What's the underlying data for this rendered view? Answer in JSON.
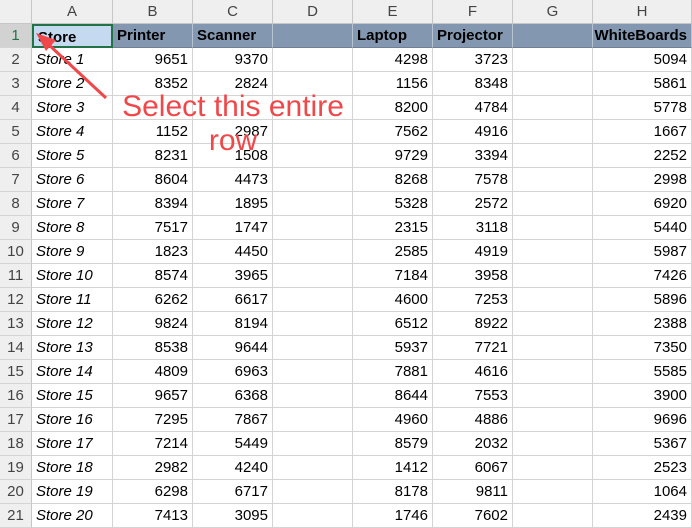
{
  "columns": [
    "A",
    "B",
    "C",
    "D",
    "E",
    "F",
    "G",
    "H"
  ],
  "row_numbers": [
    "1",
    "2",
    "3",
    "4",
    "5",
    "6",
    "7",
    "8",
    "9",
    "10",
    "11",
    "12",
    "13",
    "14",
    "15",
    "16",
    "17",
    "18",
    "19",
    "20",
    "21"
  ],
  "header_row": [
    "Store",
    "Printer",
    "Scanner",
    "",
    "Laptop",
    "Projector",
    "",
    "WhiteBoards"
  ],
  "rows": [
    [
      "Store 1",
      "9651",
      "9370",
      "",
      "4298",
      "3723",
      "",
      "5094"
    ],
    [
      "Store 2",
      "8352",
      "2824",
      "",
      "1156",
      "8348",
      "",
      "5861"
    ],
    [
      "Store 3",
      "",
      "",
      "",
      "8200",
      "4784",
      "",
      "5778"
    ],
    [
      "Store 4",
      "1152",
      "2987",
      "",
      "7562",
      "4916",
      "",
      "1667"
    ],
    [
      "Store 5",
      "8231",
      "1508",
      "",
      "9729",
      "3394",
      "",
      "2252"
    ],
    [
      "Store 6",
      "8604",
      "4473",
      "",
      "8268",
      "7578",
      "",
      "2998"
    ],
    [
      "Store 7",
      "8394",
      "1895",
      "",
      "5328",
      "2572",
      "",
      "6920"
    ],
    [
      "Store 8",
      "7517",
      "1747",
      "",
      "2315",
      "3118",
      "",
      "5440"
    ],
    [
      "Store 9",
      "1823",
      "4450",
      "",
      "2585",
      "4919",
      "",
      "5987"
    ],
    [
      "Store 10",
      "8574",
      "3965",
      "",
      "7184",
      "3958",
      "",
      "7426"
    ],
    [
      "Store 11",
      "6262",
      "6617",
      "",
      "4600",
      "7253",
      "",
      "5896"
    ],
    [
      "Store 12",
      "9824",
      "8194",
      "",
      "6512",
      "8922",
      "",
      "2388"
    ],
    [
      "Store 13",
      "8538",
      "9644",
      "",
      "5937",
      "7721",
      "",
      "7350"
    ],
    [
      "Store 14",
      "4809",
      "6963",
      "",
      "7881",
      "4616",
      "",
      "5585"
    ],
    [
      "Store 15",
      "9657",
      "6368",
      "",
      "8644",
      "7553",
      "",
      "3900"
    ],
    [
      "Store 16",
      "7295",
      "7867",
      "",
      "4960",
      "4886",
      "",
      "9696"
    ],
    [
      "Store 17",
      "7214",
      "5449",
      "",
      "8579",
      "2032",
      "",
      "5367"
    ],
    [
      "Store 18",
      "2982",
      "4240",
      "",
      "1412",
      "6067",
      "",
      "2523"
    ],
    [
      "Store 19",
      "6298",
      "6717",
      "",
      "8178",
      "9811",
      "",
      "1064"
    ],
    [
      "Store 20",
      "7413",
      "3095",
      "",
      "1746",
      "7602",
      "",
      "2439"
    ]
  ],
  "annotation": {
    "line1": "Select this entire",
    "line2": "row"
  },
  "colors": {
    "header_fill": "#8497b0",
    "selected_cell": "#c5daf0",
    "annotation": "#f0474b"
  }
}
